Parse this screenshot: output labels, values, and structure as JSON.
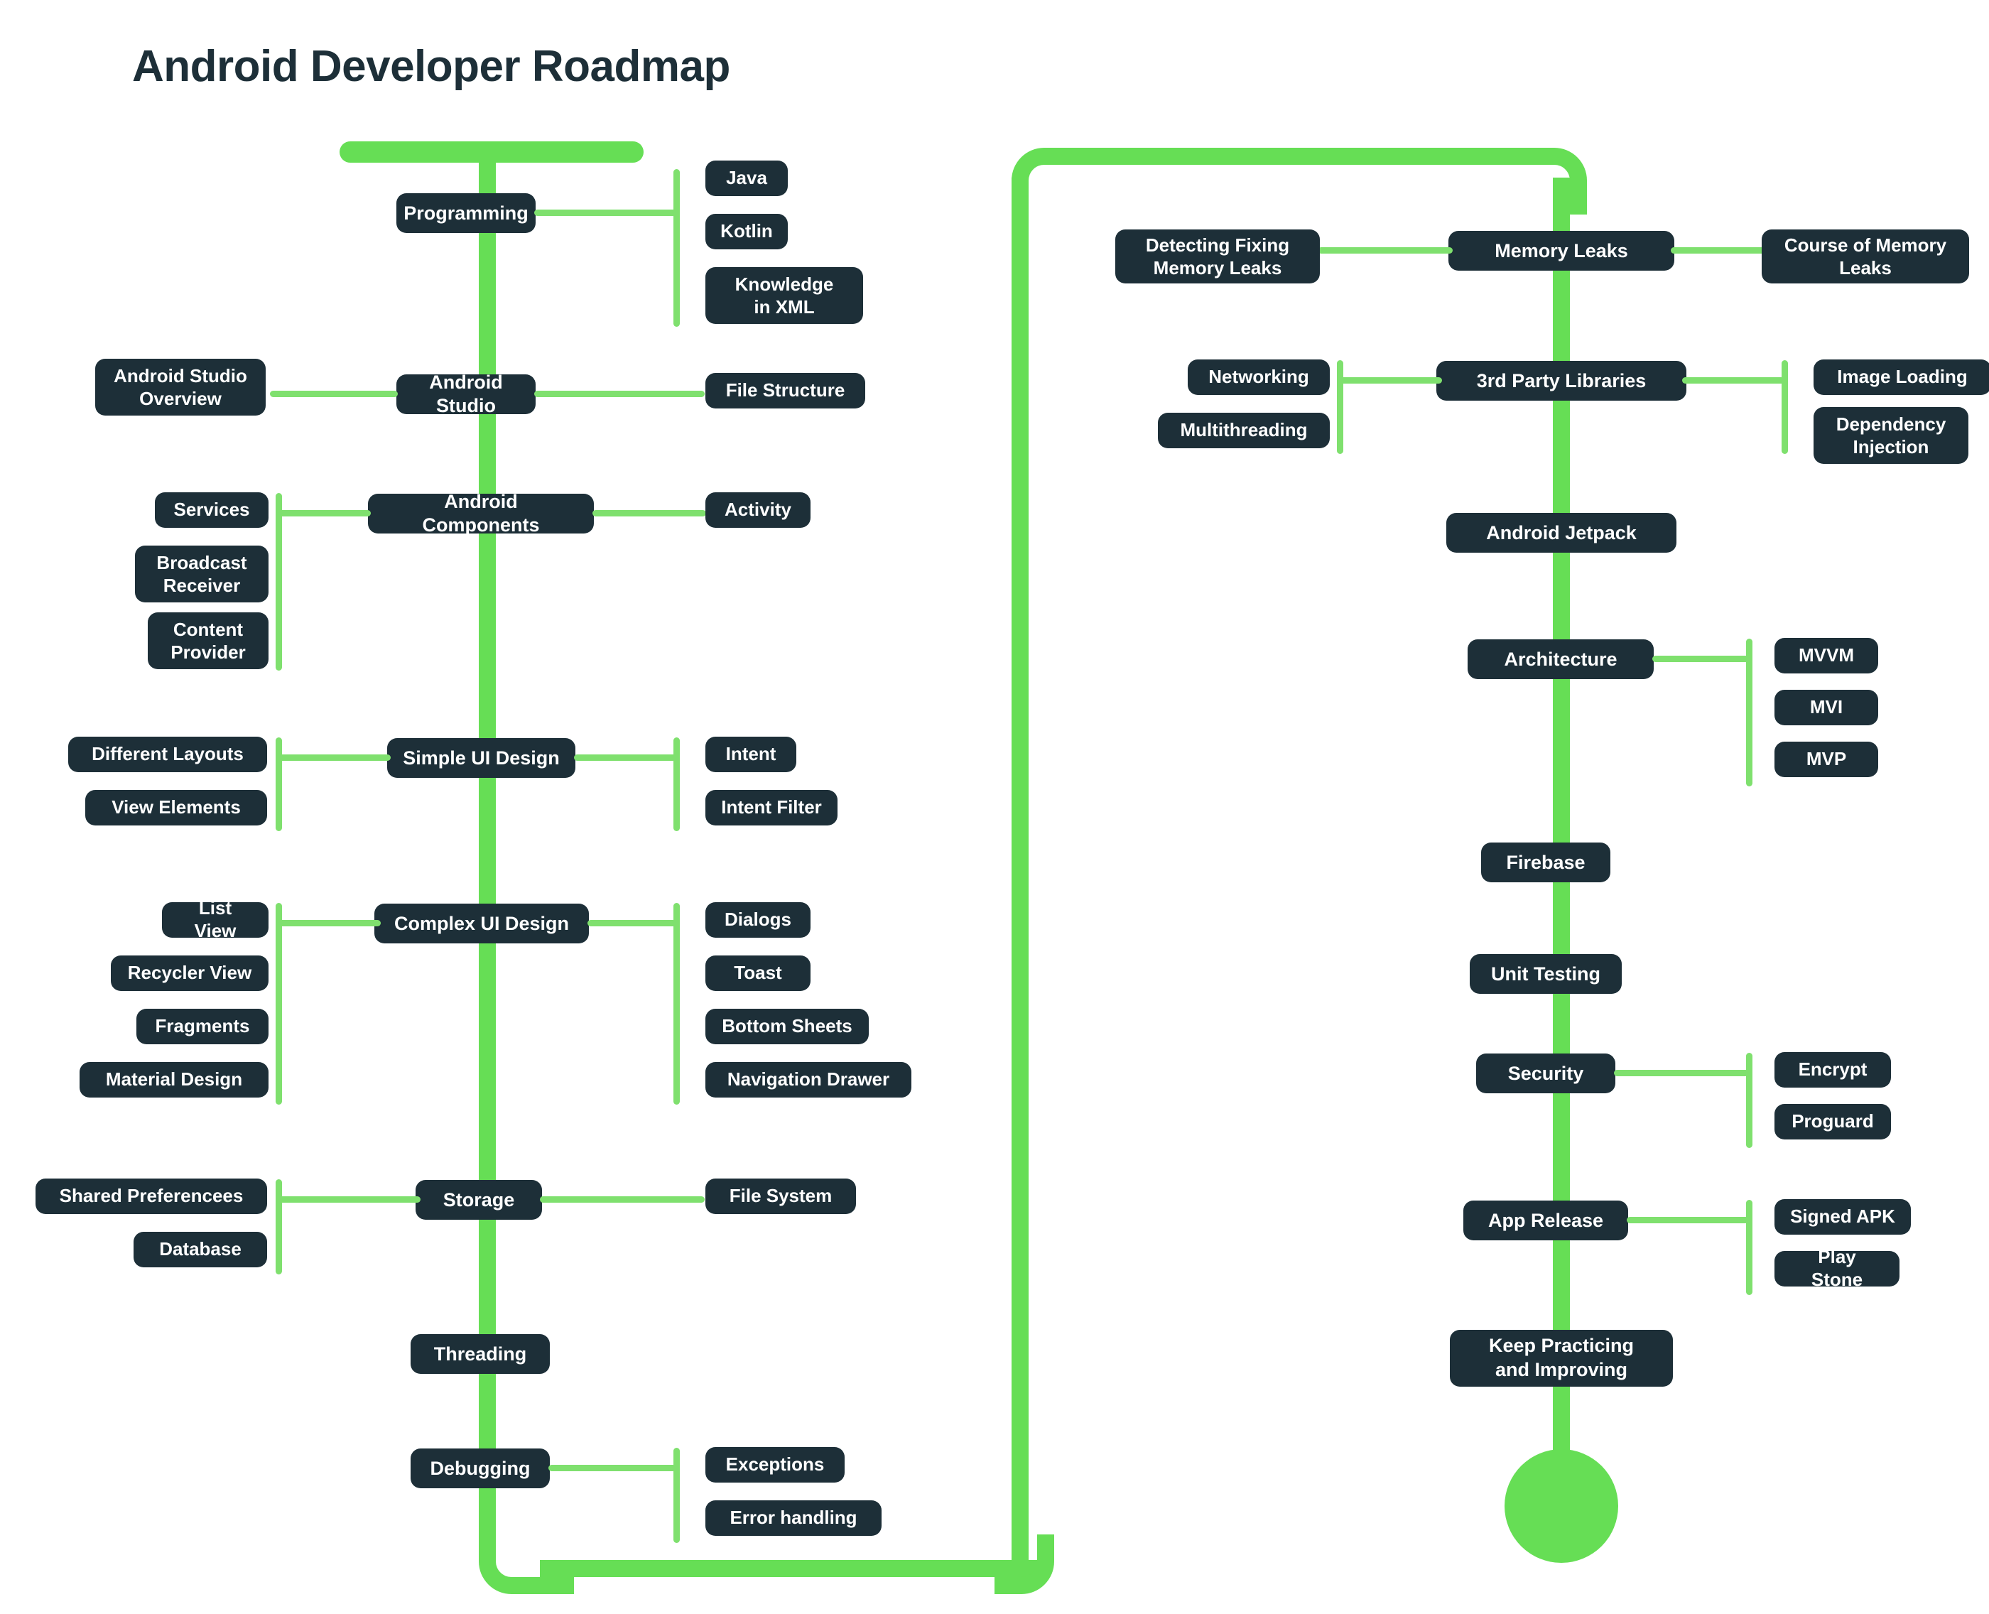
{
  "page": {
    "title": "Android Developer Roadmap",
    "background_color": "#ffffff",
    "accent_green": "#66de55",
    "connector_green": "#7fe06e",
    "node_color": "#1d2f38",
    "node_text_color": "#ffffff"
  },
  "left_column": {
    "nodes": [
      {
        "id": "programming",
        "label": "Programming"
      },
      {
        "id": "android-studio",
        "label": "Android Studio"
      },
      {
        "id": "android-components",
        "label": "Android Components"
      },
      {
        "id": "simple-ui-design",
        "label": "Simple UI Design"
      },
      {
        "id": "complex-ui-design",
        "label": "Complex UI Design"
      },
      {
        "id": "storage",
        "label": "Storage"
      },
      {
        "id": "threading",
        "label": "Threading"
      },
      {
        "id": "debugging",
        "label": "Debugging"
      }
    ],
    "branches": {
      "programming_right": [
        "Java",
        "Kotlin",
        "Knowledge\nin XML"
      ],
      "android_studio_left": [
        "Android Studio\nOverview"
      ],
      "android_studio_right": [
        "File Structure"
      ],
      "android_components_left": [
        "Services",
        "Broadcast\nReceiver",
        "Content\nProvider"
      ],
      "android_components_right": [
        "Activity"
      ],
      "simple_ui_left": [
        "Different Layouts",
        "View Elements"
      ],
      "simple_ui_right": [
        "Intent",
        "Intent Filter"
      ],
      "complex_ui_left": [
        "List View",
        "Recycler View",
        "Fragments",
        "Material Design"
      ],
      "complex_ui_right": [
        "Dialogs",
        "Toast",
        "Bottom Sheets",
        "Navigation Drawer"
      ],
      "storage_left": [
        "Shared Preferencees",
        "Database"
      ],
      "storage_right": [
        "File System"
      ],
      "debugging_right": [
        "Exceptions",
        "Error handling"
      ]
    }
  },
  "right_column": {
    "nodes": [
      {
        "id": "memory-leaks",
        "label": "Memory Leaks"
      },
      {
        "id": "third-party",
        "label": "3rd Party Libraries"
      },
      {
        "id": "android-jetpack",
        "label": "Android Jetpack"
      },
      {
        "id": "architecture",
        "label": "Architecture"
      },
      {
        "id": "firebase",
        "label": "Firebase"
      },
      {
        "id": "unit-testing",
        "label": "Unit Testing"
      },
      {
        "id": "security",
        "label": "Security"
      },
      {
        "id": "app-release",
        "label": "App Release"
      },
      {
        "id": "keep-practicing",
        "label": "Keep Practicing\nand Improving"
      }
    ],
    "branches": {
      "memory_leaks_left": [
        "Detecting Fixing\nMemory Leaks"
      ],
      "memory_leaks_right": [
        "Course of Memory\nLeaks"
      ],
      "third_party_left": [
        "Networking",
        "Multithreading"
      ],
      "third_party_right": [
        "Image Loading",
        "Dependency\nInjection"
      ],
      "architecture_right": [
        "MVVM",
        "MVI",
        "MVP"
      ],
      "security_right": [
        "Encrypt",
        "Proguard"
      ],
      "app_release_right": [
        "Signed APK",
        "Play Stone"
      ]
    }
  }
}
